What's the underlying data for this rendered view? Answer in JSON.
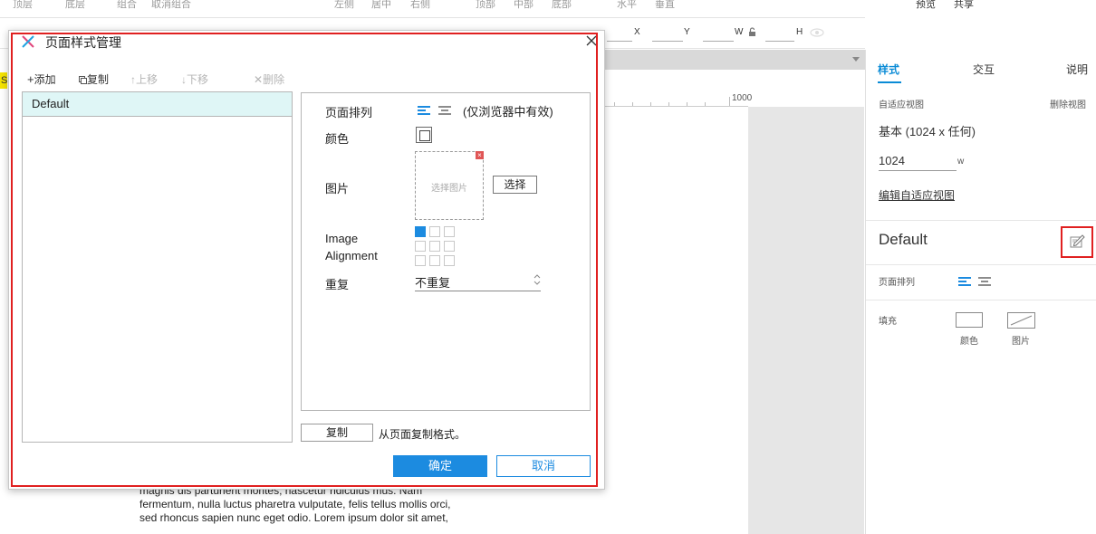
{
  "toolbar_top": {
    "items": [
      "顶层",
      "底层",
      "组合",
      "取消组合",
      "左侧",
      "居中",
      "右侧",
      "顶部",
      "中部",
      "底部",
      "水平",
      "垂直"
    ],
    "preview": "预览",
    "share": "共享"
  },
  "coords": {
    "x": "X",
    "y": "Y",
    "w": "W",
    "h": "H"
  },
  "ruler": {
    "label": "1000"
  },
  "background_text": {
    "lorem_lines": [
      "magnis dis parturient montes, nascetur ridiculus mus. Nam",
      "fermentum, nulla luctus pharetra vulputate, felis tellus mollis orci,",
      "sed rhoncus sapien nunc eget odio. Lorem ipsum dolor sit amet,"
    ],
    "sliver_letter": "S"
  },
  "right_panel": {
    "tabs": [
      "样式",
      "交互",
      "说明"
    ],
    "adaptive_view_label": "自适应视图",
    "delete_adaptive_view": "删除视图",
    "base_view": "基本 (1024 x 任何)",
    "width_value": "1024",
    "width_unit": "w",
    "edit_adaptive_view": "编辑自适应视图",
    "style_name": "Default",
    "page_align_label": "页面排列",
    "fill_label": "填充",
    "fill_color": "颜色",
    "fill_image": "图片"
  },
  "dialog": {
    "title": "页面样式管理",
    "toolbar": {
      "add": "添加",
      "copy": "复制",
      "move_up": "上移",
      "move_down": "下移",
      "delete": "删除"
    },
    "styles": [
      "Default"
    ],
    "props": {
      "page_align_label": "页面排列",
      "page_align_note": "(仅浏览器中有效)",
      "color_label": "颜色",
      "image_label": "图片",
      "image_placeholder": "选择图片",
      "choose_button": "选择",
      "image_alignment_label_1": "Image",
      "image_alignment_label_2": "Alignment",
      "repeat_label": "重复",
      "repeat_value": "不重复"
    },
    "copy_button": "复制",
    "copy_note": "从页面复制格式。",
    "ok_button": "确定",
    "cancel_button": "取消"
  },
  "colors": {
    "accent": "#1c8be0",
    "highlight_red": "#e02020",
    "list_selected": "#dff6f6"
  }
}
